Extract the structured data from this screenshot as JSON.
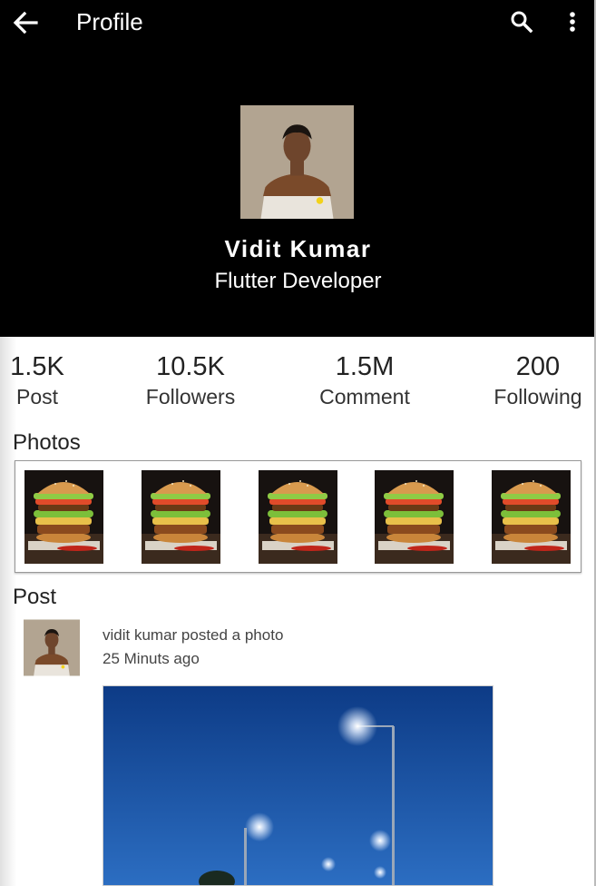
{
  "appbar": {
    "title": "Profile",
    "back_icon": "arrow-back-icon",
    "search_icon": "search-icon",
    "more_icon": "more-vert-icon"
  },
  "profile": {
    "name": "Vidit Kumar",
    "role": "Flutter Developer"
  },
  "stats": [
    {
      "value": "1.5K",
      "label": "Post"
    },
    {
      "value": "10.5K",
      "label": "Followers"
    },
    {
      "value": "1.5M",
      "label": "Comment"
    },
    {
      "value": "200",
      "label": "Following"
    }
  ],
  "photos": {
    "title": "Photos",
    "items": [
      "burger-photo",
      "burger-photo",
      "burger-photo",
      "burger-photo",
      "burger-photo"
    ]
  },
  "post": {
    "title": "Post",
    "author_line": "vidit kumar posted a photo",
    "time": "25 Minuts ago"
  },
  "colors": {
    "header_bg": "#000000",
    "text_on_header": "#ffffff",
    "body_text": "#222222"
  }
}
